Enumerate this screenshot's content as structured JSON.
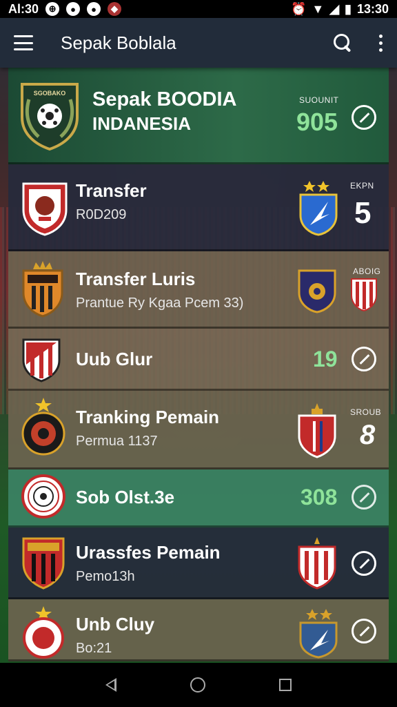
{
  "status_bar": {
    "time_left": "Al:30",
    "time_right": "13:30"
  },
  "app_bar": {
    "title": "Sepak Boblala"
  },
  "featured": {
    "title_line1": "Sepak BOODIA",
    "title_line2": "INDANESIA",
    "stat_label": "SUOUNIT",
    "stat_value": "905",
    "crest_text": "SGOBAKO"
  },
  "items": [
    {
      "name": "Transfer",
      "sub": "R0D209",
      "label": "EKPN",
      "value": "5"
    },
    {
      "name": "Transfer Luris",
      "sub": "Prantue Ry Kgaa Pcem 33)",
      "label": "ABOIG",
      "value": ""
    },
    {
      "name": "Uub Glur",
      "sub": "",
      "label": "",
      "value": "19"
    },
    {
      "name": "Tranking Pemain",
      "sub": "Permua 1137",
      "label": "SROUB",
      "value": "8"
    },
    {
      "name": "Sob Olst.3e",
      "sub": "",
      "label": "",
      "value": "308"
    },
    {
      "name": "Urassfes Pemain",
      "sub": "Pemo13h",
      "label": "",
      "value": ""
    },
    {
      "name": "Unb Cluy",
      "sub": "Bo:21",
      "label": "",
      "value": ""
    }
  ],
  "colors": {
    "accent_green": "#8fe39a",
    "app_bar": "#222c3a",
    "card_dark": "#262a3c"
  }
}
